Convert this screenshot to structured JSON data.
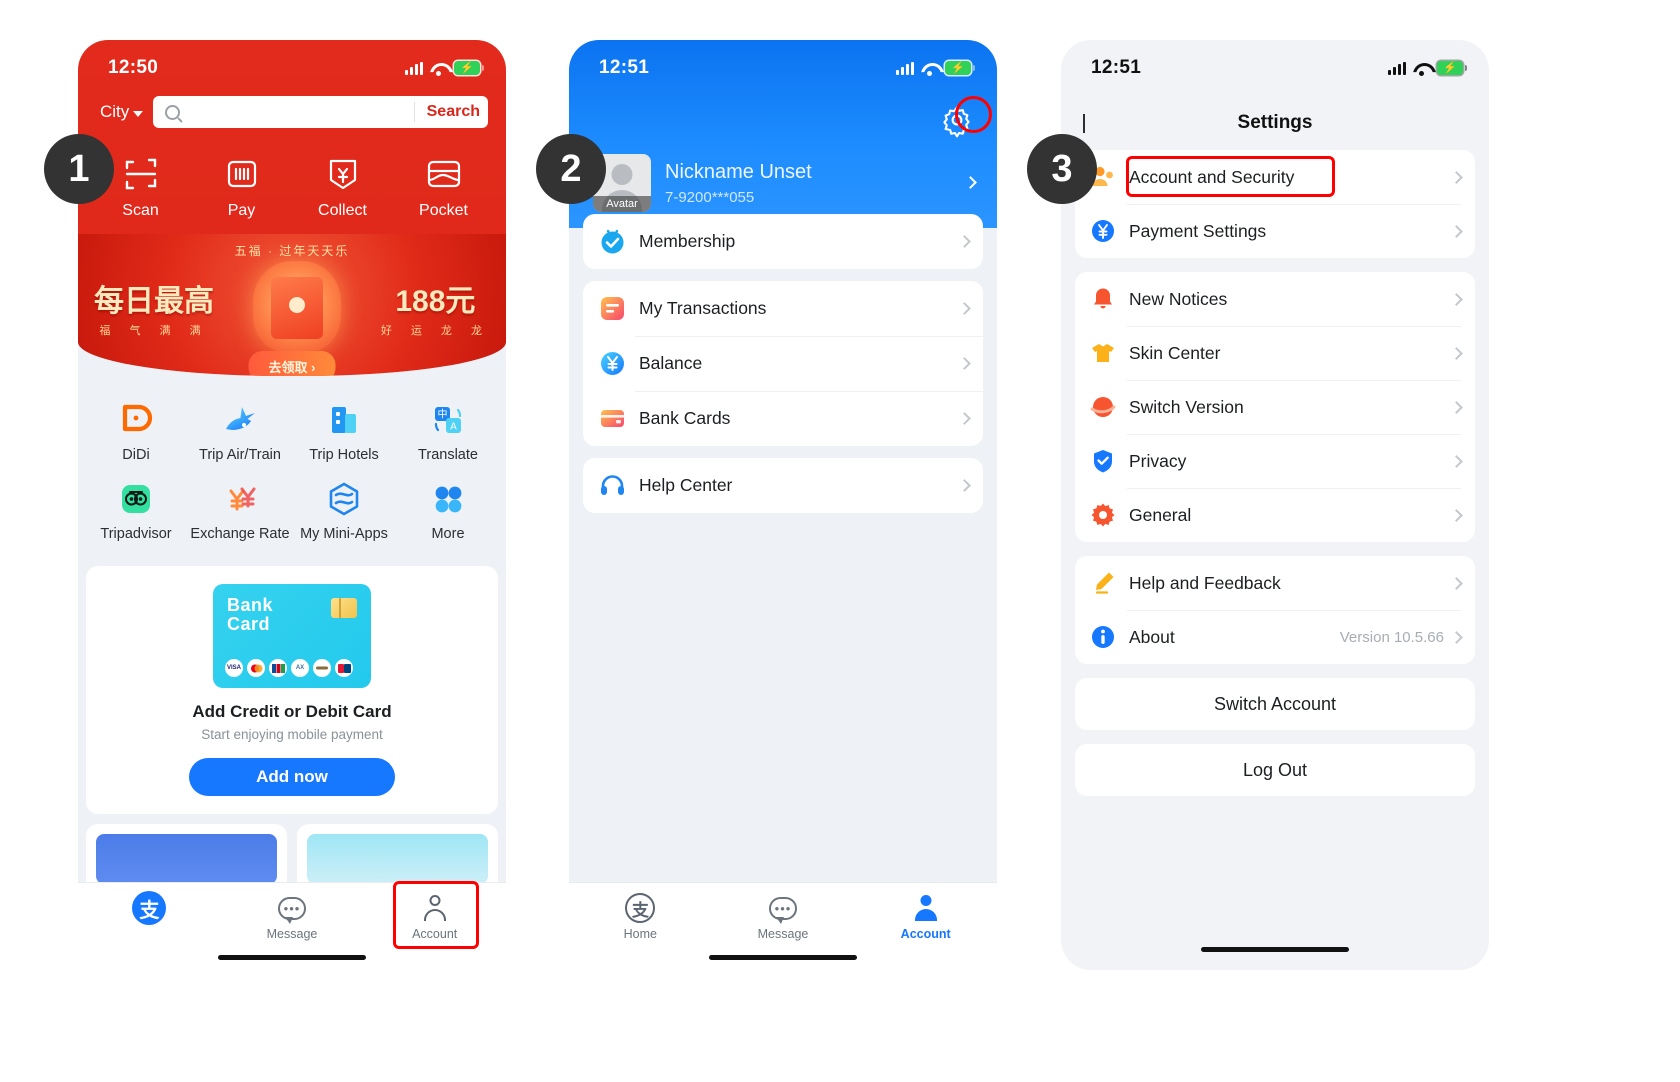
{
  "phone1": {
    "status": {
      "time": "12:50",
      "signal_icon": "signal-bars-icon",
      "wifi_icon": "wifi-icon",
      "battery_icon": "battery-charging-icon"
    },
    "search": {
      "city_label": "City",
      "placeholder": "",
      "value": "",
      "search_button": "Search",
      "search_icon": "search-icon"
    },
    "quick_actions": [
      {
        "label": "Scan",
        "icon": "scan-icon"
      },
      {
        "label": "Pay",
        "icon": "barcode-pay-icon"
      },
      {
        "label": "Collect",
        "icon": "collect-money-icon"
      },
      {
        "label": "Pocket",
        "icon": "pocket-wallet-icon"
      }
    ],
    "banner": {
      "headline_top": "五福 · 过年天天乐",
      "left_big": "每日最高",
      "left_small": "福 气 满 满",
      "right_big": "188元",
      "right_small": "好 运 龙 龙",
      "cta": "去领取 ›"
    },
    "app_grid": [
      {
        "label": "DiDi",
        "icon": "didi-icon"
      },
      {
        "label": "Trip Air/Train",
        "icon": "trip-air-train-icon"
      },
      {
        "label": "Trip Hotels",
        "icon": "trip-hotels-icon"
      },
      {
        "label": "Translate",
        "icon": "translate-icon"
      },
      {
        "label": "Tripadvisor",
        "icon": "tripadvisor-icon"
      },
      {
        "label": "Exchange Rate",
        "icon": "exchange-rate-icon"
      },
      {
        "label": "My Mini-Apps",
        "icon": "mini-apps-icon"
      },
      {
        "label": "More",
        "icon": "more-grid-icon"
      }
    ],
    "bank_card": {
      "card_title_line1": "Bank",
      "card_title_line2": "Card",
      "chip_icon": "card-chip-icon",
      "network_logos": [
        "VISA",
        "mastercard",
        "jcb",
        "amex",
        "diners",
        "unionpay"
      ],
      "title": "Add Credit or Debit Card",
      "subtitle": "Start enjoying mobile payment",
      "button": "Add now"
    },
    "tabs": [
      {
        "label": "",
        "icon": "alipay-logo-icon",
        "active": true
      },
      {
        "label": "Message",
        "icon": "message-bubble-icon",
        "active": false
      },
      {
        "label": "Account",
        "icon": "account-person-icon",
        "active": false
      }
    ]
  },
  "phone2": {
    "status": {
      "time": "12:51",
      "signal_icon": "signal-bars-icon",
      "wifi_icon": "wifi-icon",
      "battery_icon": "battery-charging-icon"
    },
    "settings_icon": "gear-icon",
    "user": {
      "avatar_label": "Avatar",
      "nickname": "Nickname Unset",
      "phone": "7-9200***055",
      "chevron_icon": "chevron-right-icon"
    },
    "groups": [
      {
        "rows": [
          {
            "label": "Membership",
            "icon": "membership-icon"
          }
        ]
      },
      {
        "rows": [
          {
            "label": "My Transactions",
            "icon": "transactions-icon"
          },
          {
            "label": "Balance",
            "icon": "balance-yuan-icon"
          },
          {
            "label": "Bank Cards",
            "icon": "bank-cards-icon"
          }
        ]
      },
      {
        "rows": [
          {
            "label": "Help Center",
            "icon": "headset-help-icon"
          }
        ]
      }
    ],
    "tabs": [
      {
        "label": "Home",
        "icon": "alipay-logo-icon",
        "active": false
      },
      {
        "label": "Message",
        "icon": "message-bubble-icon",
        "active": false
      },
      {
        "label": "Account",
        "icon": "account-person-icon",
        "active": true
      }
    ]
  },
  "phone3": {
    "status": {
      "time": "12:51",
      "signal_icon": "signal-bars-icon",
      "wifi_icon": "wifi-icon",
      "battery_icon": "battery-charging-icon"
    },
    "nav": {
      "back_icon": "chevron-left-icon",
      "title": "Settings"
    },
    "groups": [
      {
        "rows": [
          {
            "label": "Account and Security",
            "icon": "account-security-icon",
            "value": ""
          },
          {
            "label": "Payment Settings",
            "icon": "payment-yuan-icon",
            "value": ""
          }
        ]
      },
      {
        "rows": [
          {
            "label": "New Notices",
            "icon": "bell-icon",
            "value": ""
          },
          {
            "label": "Skin Center",
            "icon": "tshirt-icon",
            "value": ""
          },
          {
            "label": "Switch Version",
            "icon": "switch-version-icon",
            "value": ""
          },
          {
            "label": "Privacy",
            "icon": "shield-check-icon",
            "value": ""
          },
          {
            "label": "General",
            "icon": "gear-icon",
            "value": ""
          }
        ]
      },
      {
        "rows": [
          {
            "label": "Help and Feedback",
            "icon": "pencil-feedback-icon",
            "value": ""
          },
          {
            "label": "About",
            "icon": "info-icon",
            "value": "Version 10.5.66"
          }
        ]
      }
    ],
    "actions": [
      {
        "label": "Switch Account"
      },
      {
        "label": "Log Out"
      }
    ]
  },
  "steps": [
    {
      "number": "1"
    },
    {
      "number": "2"
    },
    {
      "number": "3"
    }
  ],
  "highlights": {
    "account_tab": "account-tab-highlight",
    "gear": "settings-gear-highlight",
    "account_security": "account-and-security-highlight"
  },
  "colors": {
    "alipay_red": "#e22b1c",
    "alipay_blue": "#1677ff",
    "highlight_red": "#ff0000",
    "step_badge": "#333333",
    "page_bg": "#eef1f5"
  }
}
